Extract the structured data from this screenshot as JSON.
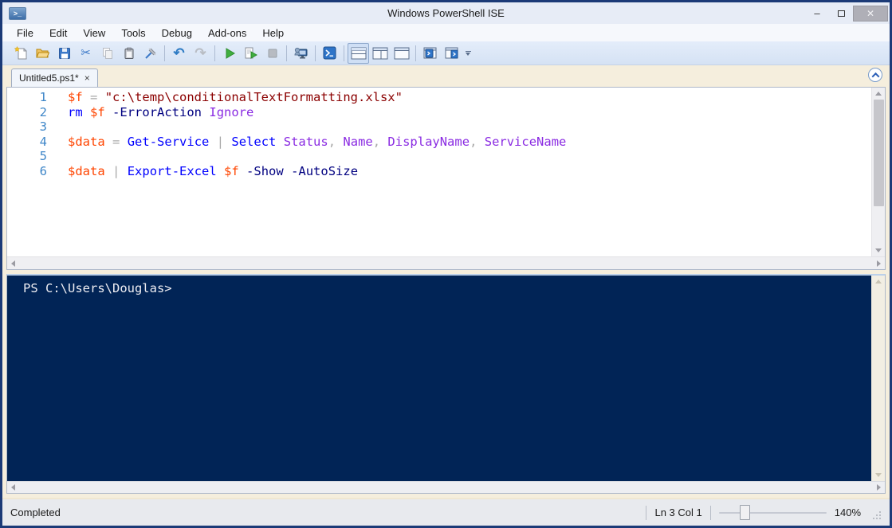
{
  "window": {
    "title": "Windows PowerShell ISE",
    "controls": {
      "minimize": "–",
      "close": "✕"
    }
  },
  "menu": {
    "items": [
      "File",
      "Edit",
      "View",
      "Tools",
      "Debug",
      "Add-ons",
      "Help"
    ]
  },
  "toolbar": {
    "icons": [
      "new-script",
      "open-script",
      "save",
      "cut",
      "copy",
      "paste",
      "clear-console-pane",
      "undo",
      "redo",
      "run-script",
      "run-selection",
      "stop-operation",
      "new-remote-powershell-tab",
      "start-powershell",
      "show-script-pane-top",
      "show-script-pane-right",
      "show-script-pane-maximized",
      "show-command-window",
      "show-command-addon",
      "toolbar-overflow"
    ],
    "undo_glyph": "↶",
    "redo_glyph": "↷",
    "cut_glyph": "✂"
  },
  "tab": {
    "label": "Untitled5.ps1*",
    "close": "×"
  },
  "editor": {
    "lines": [
      {
        "num": "1",
        "tokens": [
          {
            "t": "$f",
            "c": "var"
          },
          {
            "t": " ",
            "c": "pln"
          },
          {
            "t": "=",
            "c": "op"
          },
          {
            "t": " ",
            "c": "pln"
          },
          {
            "t": "\"c:\\temp\\conditionalTextFormatting.xlsx\"",
            "c": "str"
          }
        ]
      },
      {
        "num": "2",
        "tokens": [
          {
            "t": "rm",
            "c": "cmd"
          },
          {
            "t": " ",
            "c": "pln"
          },
          {
            "t": "$f",
            "c": "var"
          },
          {
            "t": " ",
            "c": "pln"
          },
          {
            "t": "-ErrorAction",
            "c": "prm"
          },
          {
            "t": " ",
            "c": "pln"
          },
          {
            "t": "Ignore",
            "c": "arg"
          }
        ]
      },
      {
        "num": "3",
        "tokens": []
      },
      {
        "num": "4",
        "tokens": [
          {
            "t": "$data",
            "c": "var"
          },
          {
            "t": " ",
            "c": "pln"
          },
          {
            "t": "=",
            "c": "op"
          },
          {
            "t": " ",
            "c": "pln"
          },
          {
            "t": "Get-Service",
            "c": "cmd"
          },
          {
            "t": " ",
            "c": "pln"
          },
          {
            "t": "|",
            "c": "op"
          },
          {
            "t": " ",
            "c": "pln"
          },
          {
            "t": "Select",
            "c": "cmd"
          },
          {
            "t": " ",
            "c": "pln"
          },
          {
            "t": "Status",
            "c": "arg"
          },
          {
            "t": ", ",
            "c": "op"
          },
          {
            "t": "Name",
            "c": "arg"
          },
          {
            "t": ", ",
            "c": "op"
          },
          {
            "t": "DisplayName",
            "c": "arg"
          },
          {
            "t": ", ",
            "c": "op"
          },
          {
            "t": "ServiceName",
            "c": "arg"
          }
        ]
      },
      {
        "num": "5",
        "tokens": []
      },
      {
        "num": "6",
        "tokens": [
          {
            "t": "$data",
            "c": "var"
          },
          {
            "t": " ",
            "c": "pln"
          },
          {
            "t": "|",
            "c": "op"
          },
          {
            "t": " ",
            "c": "pln"
          },
          {
            "t": "Export-Excel",
            "c": "cmd"
          },
          {
            "t": " ",
            "c": "pln"
          },
          {
            "t": "$f",
            "c": "var"
          },
          {
            "t": " ",
            "c": "pln"
          },
          {
            "t": "-Show",
            "c": "prm"
          },
          {
            "t": " ",
            "c": "pln"
          },
          {
            "t": "-AutoSize",
            "c": "prm"
          }
        ]
      }
    ]
  },
  "console": {
    "prompt": "PS C:\\Users\\Douglas>"
  },
  "statusbar": {
    "status": "Completed",
    "position": "Ln 3 Col 1",
    "zoom_level": "140%"
  },
  "colors": {
    "window_border": "#1B3A77",
    "console_background": "#012456",
    "syntax_variable": "#FF4500",
    "syntax_command": "#0000FF",
    "syntax_parameter": "#000080",
    "syntax_argument": "#8A2BE2",
    "syntax_string": "#8B0000",
    "syntax_operator": "#A9A9A9",
    "line_number": "#3E86C8"
  }
}
